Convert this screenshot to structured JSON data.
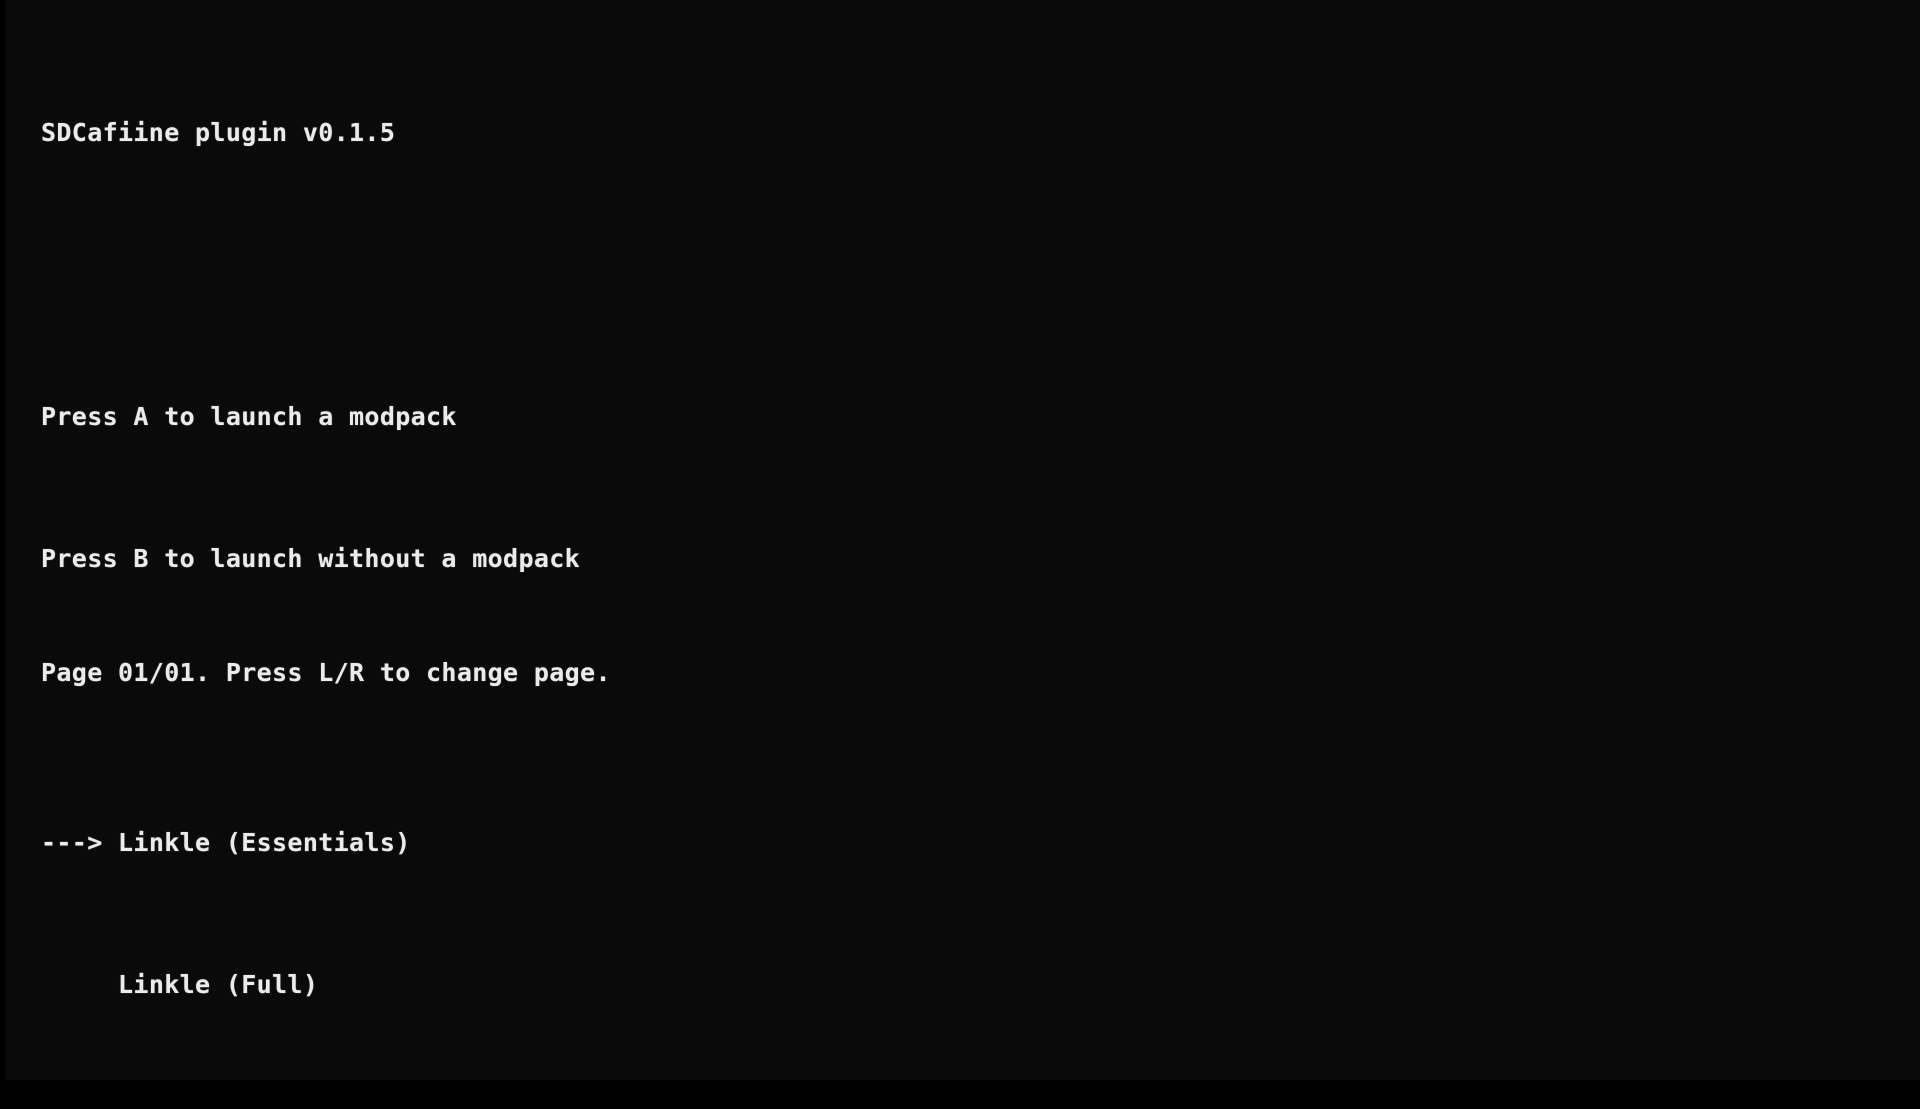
{
  "screen": {
    "background_color": "#0a0a0a",
    "text_color": "#ebebeb",
    "title": "SDCafiine plugin v0.1.5"
  },
  "instructions": {
    "launch_modpack": "Press A to launch a modpack",
    "launch_without_modpack": "Press B to launch without a modpack"
  },
  "menu": {
    "selector_glyph": "--->",
    "indent": "     ",
    "selected_index": 0,
    "items": [
      {
        "label": "Linkle (Essentials)",
        "selected": true,
        "prefix": "---> "
      },
      {
        "label": "Linkle (Full)",
        "selected": false,
        "prefix": "     "
      }
    ]
  },
  "footer": {
    "text": "Page 01/01. Press L/R to change page.",
    "page_current": "01",
    "page_total": "01",
    "page_hint": "Press L/R to change page."
  },
  "spacer": " "
}
